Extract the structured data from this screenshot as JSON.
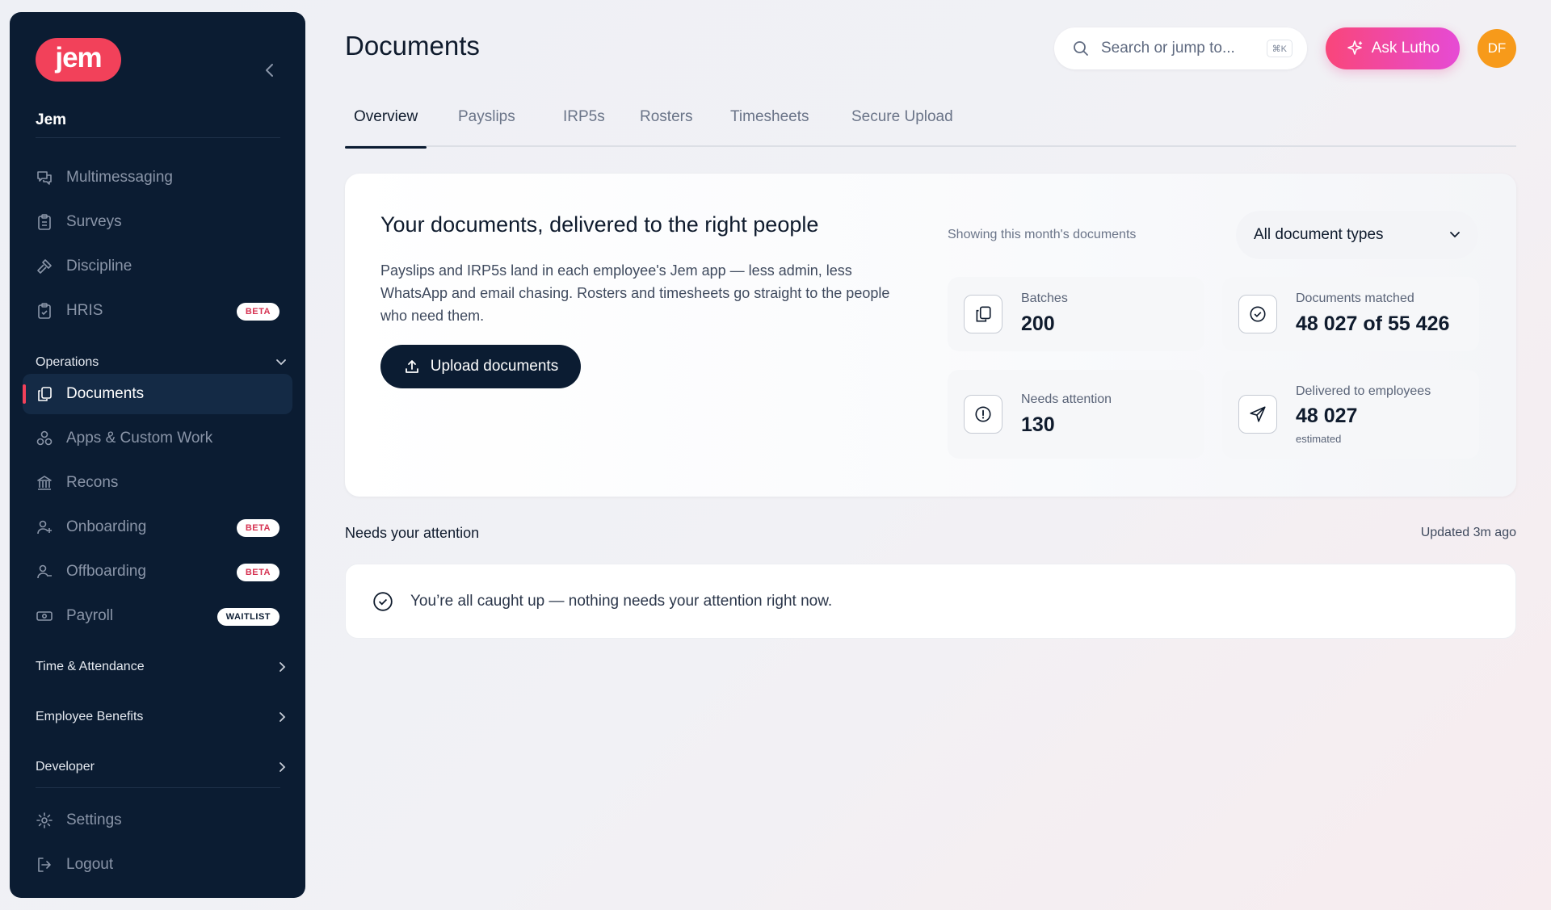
{
  "sidebar": {
    "logo_text": "jem",
    "org_name": "Jem",
    "items_top": [
      {
        "label": "Multimessaging",
        "icon": "chat-bubbles-icon"
      },
      {
        "label": "Surveys",
        "icon": "clipboard-icon"
      },
      {
        "label": "Discipline",
        "icon": "gavel-icon"
      },
      {
        "label": "HRIS",
        "icon": "clipboard-check-icon",
        "badge": "BETA"
      }
    ],
    "operations_label": "Operations",
    "items_ops": [
      {
        "label": "Documents",
        "icon": "documents-icon",
        "active": true
      },
      {
        "label": "Apps & Custom Work",
        "icon": "apps-icon"
      },
      {
        "label": "Recons",
        "icon": "bank-icon"
      },
      {
        "label": "Onboarding",
        "icon": "user-plus-icon",
        "badge": "BETA"
      },
      {
        "label": "Offboarding",
        "icon": "user-minus-icon",
        "badge": "BETA"
      },
      {
        "label": "Payroll",
        "icon": "cash-icon",
        "badge": "WAITLIST"
      }
    ],
    "sections": [
      {
        "label": "Time & Attendance"
      },
      {
        "label": "Employee Benefits"
      },
      {
        "label": "Developer"
      }
    ],
    "bottom": [
      {
        "label": "Settings",
        "icon": "gear-icon"
      },
      {
        "label": "Logout",
        "icon": "logout-icon"
      }
    ]
  },
  "header": {
    "title": "Documents",
    "search_placeholder": "Search or jump to...",
    "search_shortcut": "⌘K",
    "ask_label": "Ask Lutho",
    "avatar_initials": "DF"
  },
  "tabs": [
    {
      "label": "Overview",
      "active": true
    },
    {
      "label": "Payslips"
    },
    {
      "label": "IRP5s"
    },
    {
      "label": "Rosters"
    },
    {
      "label": "Timesheets"
    },
    {
      "label": "Secure Upload"
    }
  ],
  "hero": {
    "title": "Your documents, delivered to the right people",
    "description": "Payslips and IRP5s land in each employee's Jem app — less admin, less WhatsApp and email chasing. Rosters and timesheets go straight to the people who need them.",
    "upload_label": "Upload documents",
    "showing_text": "Showing this month's documents",
    "filter_value": "All document types",
    "stats": {
      "batches": {
        "label": "Batches",
        "value": "200"
      },
      "matched": {
        "label": "Documents matched",
        "value": "48 027 of 55 426"
      },
      "attention": {
        "label": "Needs attention",
        "value": "130"
      },
      "delivered": {
        "label": "Delivered to employees",
        "value": "48 027",
        "sub": "estimated"
      }
    }
  },
  "attention": {
    "title": "Needs your attention",
    "updated": "Updated 3m ago",
    "empty_message": "You’re all caught up — nothing needs your attention right now."
  },
  "colors": {
    "sidebar_bg": "#0b1c32",
    "brand": "#f2415a",
    "ask_gradient_start": "#f9467a",
    "ask_gradient_end": "#e64bd5",
    "avatar": "#f79a1a"
  }
}
